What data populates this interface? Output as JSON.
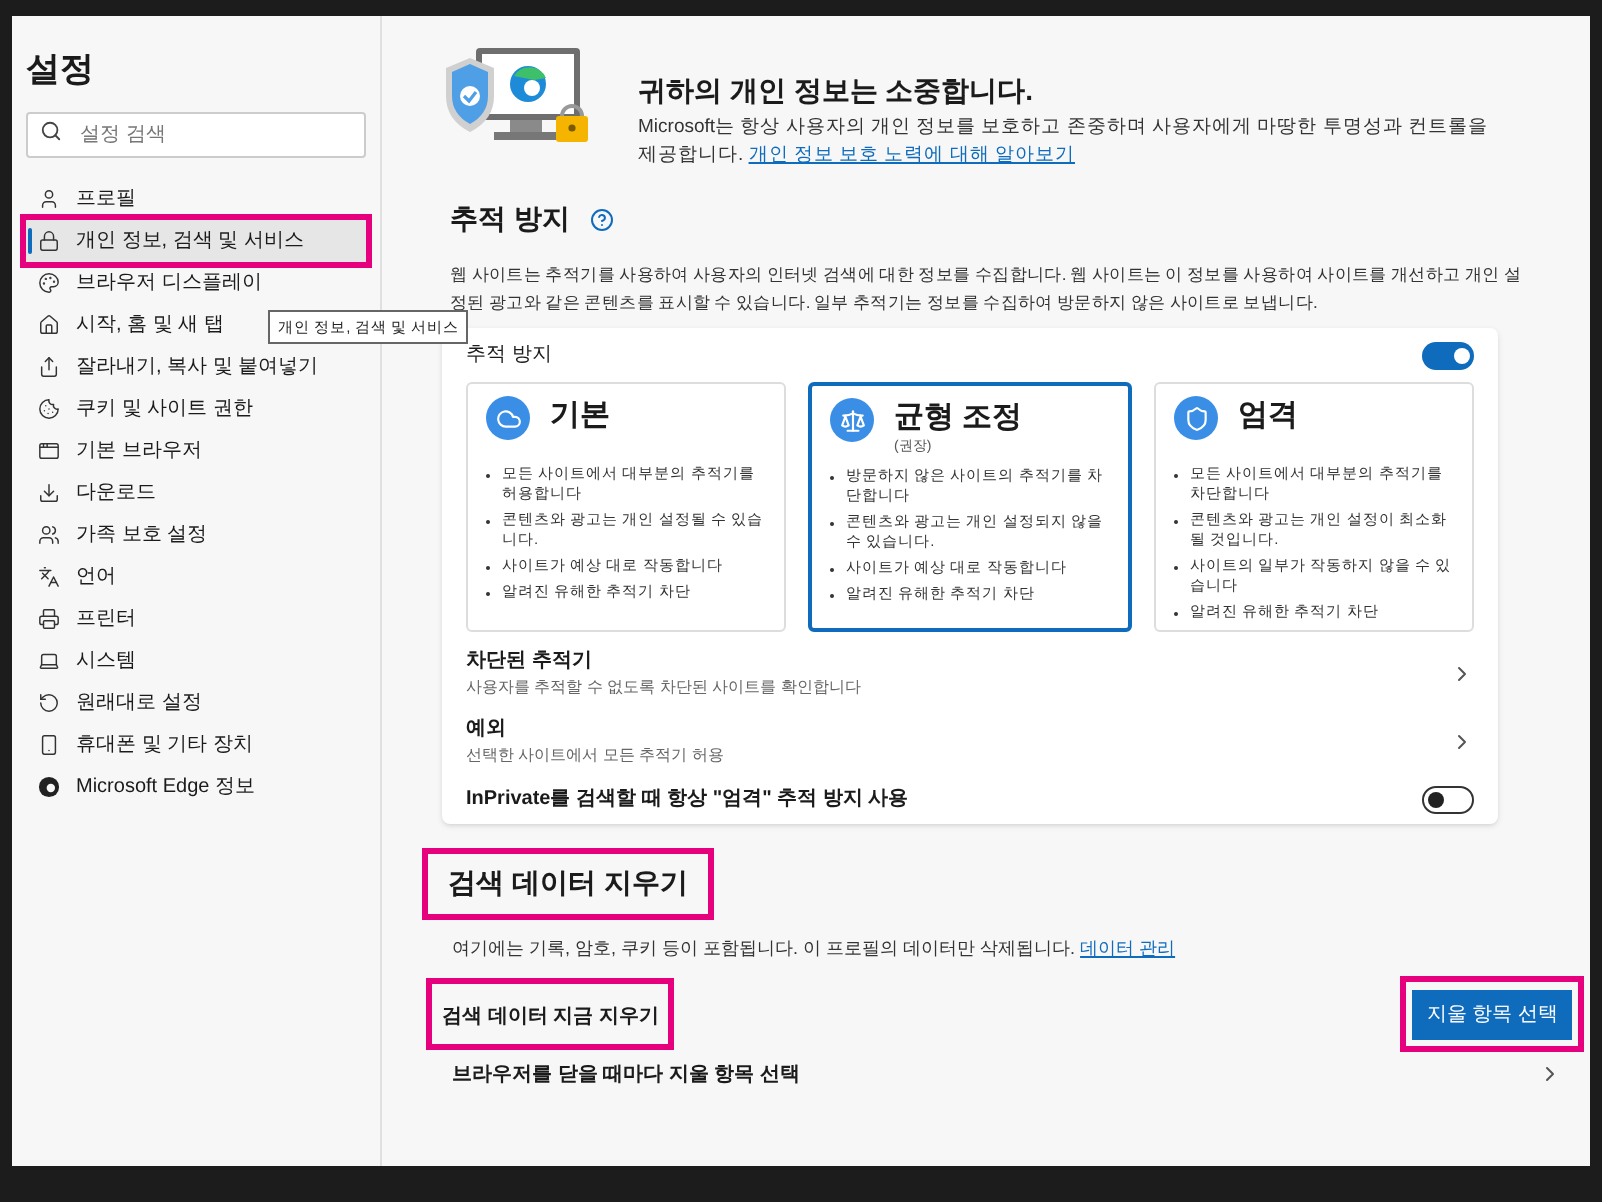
{
  "sidebar": {
    "title": "설정",
    "search": {
      "placeholder": "설정 검색"
    },
    "items": [
      {
        "label": "프로필",
        "selected": false,
        "highlighted": false
      },
      {
        "label": "개인 정보, 검색 및 서비스",
        "selected": true,
        "highlighted": true
      },
      {
        "label": "브라우저 디스플레이",
        "selected": false,
        "highlighted": false
      },
      {
        "label": "시작, 홈 및 새 탭",
        "selected": false,
        "highlighted": false
      },
      {
        "label": "잘라내기, 복사 및 붙여넣기",
        "selected": false,
        "highlighted": false
      },
      {
        "label": "쿠키 및 사이트 권한",
        "selected": false,
        "highlighted": false
      },
      {
        "label": "기본 브라우저",
        "selected": false,
        "highlighted": false
      },
      {
        "label": "다운로드",
        "selected": false,
        "highlighted": false
      },
      {
        "label": "가족 보호 설정",
        "selected": false,
        "highlighted": false
      },
      {
        "label": "언어",
        "selected": false,
        "highlighted": false
      },
      {
        "label": "프린터",
        "selected": false,
        "highlighted": false
      },
      {
        "label": "시스템",
        "selected": false,
        "highlighted": false
      },
      {
        "label": "원래대로 설정",
        "selected": false,
        "highlighted": false
      },
      {
        "label": "휴대폰 및 기타 장치",
        "selected": false,
        "highlighted": false
      },
      {
        "label": "Microsoft Edge 정보",
        "selected": false,
        "highlighted": false
      }
    ],
    "tooltip": "개인 정보, 검색 및 서비스"
  },
  "header": {
    "title": "귀하의 개인 정보는 소중합니다.",
    "text": "Microsoft는 항상 사용자의 개인 정보를 보호하고 존중하며 사용자에게 마땅한 투명성과 컨트롤을 제공합니다.",
    "link": "개인 정보 보호 노력에 대해 알아보기"
  },
  "tracking": {
    "title": "추적 방지",
    "description": "웹 사이트는 추적기를 사용하여 사용자의 인터넷 검색에 대한 정보를 수집합니다. 웹 사이트는 이 정보를 사용하여 사이트를 개선하고 개인 설정된 광고와 같은 콘텐츠를 표시할 수 있습니다. 일부 추적기는 정보를 수집하여 방문하지 않은 사이트로 보냅니다.",
    "toggle_label": "추적 방지",
    "on": true,
    "levels": [
      {
        "title": "기본",
        "selected": false,
        "bullets": [
          "모든 사이트에서 대부분의 추적기를 허용합니다",
          "콘텐츠와 광고는 개인 설정될 수 있습니다.",
          "사이트가 예상 대로 작동합니다",
          "알려진 유해한 추적기 차단"
        ]
      },
      {
        "title": "균형 조정",
        "subtitle": "(권장)",
        "selected": true,
        "bullets": [
          "방문하지 않은 사이트의 추적기를 차단합니다",
          "콘텐츠와 광고는 개인 설정되지 않을 수 있습니다.",
          "사이트가 예상 대로 작동합니다",
          "알려진 유해한 추적기 차단"
        ]
      },
      {
        "title": "엄격",
        "selected": false,
        "bullets": [
          "모든 사이트에서 대부분의 추적기를 차단합니다",
          "콘텐츠와 광고는 개인 설정이 최소화될 것입니다.",
          "사이트의 일부가 작동하지 않을 수 있습니다",
          "알려진 유해한 추적기 차단"
        ]
      }
    ],
    "rows": [
      {
        "title": "차단된 추적기",
        "subtitle": "사용자를 추적할 수 없도록 차단된 사이트를 확인합니다"
      },
      {
        "title": "예외",
        "subtitle": "선택한 사이트에서 모든 추적기 허용"
      }
    ],
    "inprivate": {
      "label": "InPrivate를 검색할 때 항상 \"엄격\" 추적 방지 사용",
      "on": false
    }
  },
  "clear": {
    "title": "검색 데이터 지우기",
    "text": "여기에는 기록, 암호, 쿠키 등이 포함됩니다. 이 프로필의 데이터만 삭제됩니다.",
    "link": "데이터 관리",
    "now_label": "검색 데이터 지금 지우기",
    "button": "지울 항목 선택",
    "on_close": "브라우저를 닫을 때마다 지울 항목 선택"
  }
}
